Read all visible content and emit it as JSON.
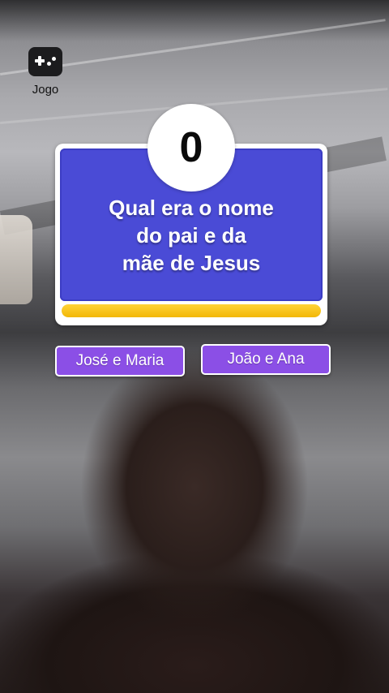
{
  "app": {
    "game_label": "Jogo",
    "game_icon": "gamepad-icon"
  },
  "quiz": {
    "score": "0",
    "question": "Qual era o nome\ndo pai e da\nmãe de Jesus",
    "timer_progress": 1.0,
    "answers": [
      {
        "label": "José e Maria"
      },
      {
        "label": "João e Ana"
      }
    ]
  },
  "colors": {
    "card_blue": "#4a4bd6",
    "answer_purple": "#8b4fe6",
    "timer_yellow": "#f2b705"
  }
}
